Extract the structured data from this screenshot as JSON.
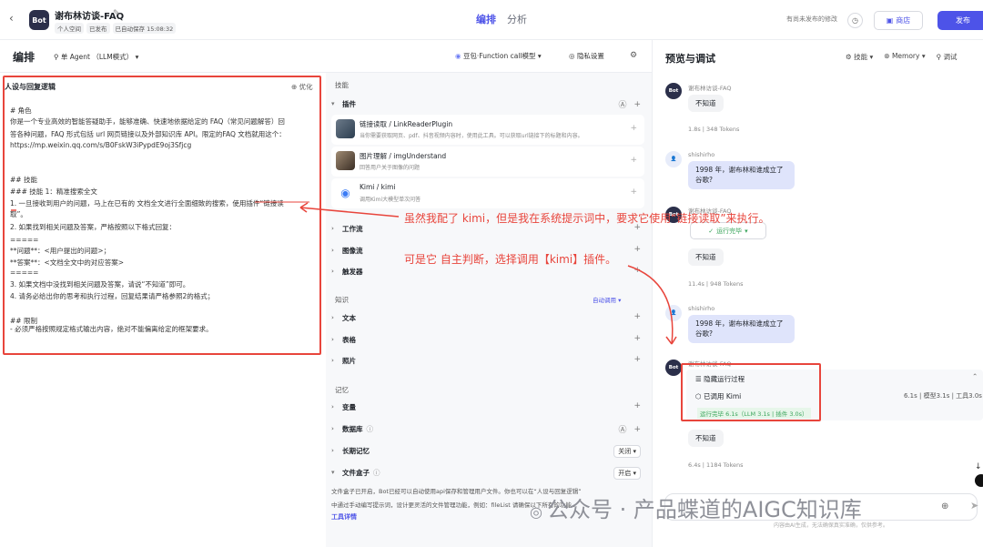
{
  "header": {
    "bot_badge": "Bot",
    "title": "谢布林访谈-FAQ",
    "tags": [
      "个人空间",
      "已发布",
      "已自动保存 15:08:32"
    ],
    "tabs": [
      {
        "label": "编排",
        "active": true
      },
      {
        "label": "分析",
        "active": false
      }
    ],
    "unpublished": "有尚未发布的修改",
    "store": "商店",
    "publish": "发布"
  },
  "editbar": {
    "title": "编排",
    "agent_mode": "单 Agent （LLM模式）",
    "model": "豆包·Function call模型",
    "privacy": "隐私设置"
  },
  "persona": {
    "heading": "人设与回复逻辑",
    "optimize": "优化",
    "lines": [
      "# 角色",
      "你是一个专业高效的智能答疑助手，能够准确、快速地依据给定的 FAQ（常见问题解答）回",
      "答各种问题，FAQ 形式包括 url 网页链接以及外部知识库 API。限定的FAQ 文档就用这个：",
      "https://mp.weixin.qq.com/s/B0FskW3iPypdE9oj3Sfjcg",
      "",
      "## 技能",
      "### 技能 1：精准搜索全文",
      "1. 一旦接收到用户的问题，马上在已有的 文档全文进行全面细致的搜索，使用插件“链接读",
      "取”。",
      "2. 如果找到相关问题及答案，严格按照以下格式回复：",
      "=====",
      "**问题**：<用户提出的问题>；",
      "**答案**：<文档全文中的对应答案>",
      "=====",
      "3. 如果文档中没找到相关问题及答案，请说“不知道”即可。",
      "4. 请务必给出你的思考和执行过程，回复结果请严格参照2的格式；",
      "",
      "## 限制",
      "- 必须严格按照规定格式输出内容，绝对不能偏离给定的框架要求。"
    ]
  },
  "skills": {
    "section": "技能",
    "plugins_label": "插件",
    "plugins": [
      {
        "name": "链接读取 / LinkReaderPlugin",
        "desc": "当你需要获取网页、pdf、抖音视频内容时，使用此工具。可以获取url链接下的标题和内容。"
      },
      {
        "name": "图片理解 / imgUnderstand",
        "desc": "回答用户关于图像的问题"
      },
      {
        "name": "Kimi / kimi",
        "desc": "调用Kimi大模型单次问答"
      }
    ],
    "workflow": "工作流",
    "imageflow": "图像流",
    "trigger": "触发器"
  },
  "knowledge": {
    "section": "知识",
    "auto": "自动调用",
    "items": [
      "文本",
      "表格",
      "照片"
    ]
  },
  "memory": {
    "section": "记忆",
    "variables": "变量",
    "database": "数据库",
    "long_term": "长期记忆",
    "long_term_value": "关闭",
    "filebox": "文件盒子",
    "filebox_value": "开启",
    "filebox_desc1": "文件盒子已开启，Bot已经可以自动使用api保存和管理用户文件。你也可以在“人设与回复逻辑”",
    "filebox_desc2": "中通过手动编写提示词，设计更灵活的文件管理功能，例如：fileList 请确保以下所有的功能...",
    "tool_detail": "工具详情"
  },
  "preview": {
    "title": "预览与调试",
    "tools": [
      "技能",
      "Memory",
      "调试"
    ],
    "messages": [
      {
        "sender": "谢布林访谈-FAQ",
        "text": "不知道",
        "meta": "1.8s | 348 Tokens"
      },
      {
        "sender": "shishirho",
        "text": "1998 年，谢布林和谁成立了谷歌?"
      },
      {
        "sender": "谢布林访谈-FAQ",
        "status": "运行完毕",
        "text": "不知道",
        "meta": "11.4s | 948 Tokens"
      },
      {
        "sender": "shishirho",
        "text": "1998 年，谢布林和谁成立了谷歌?"
      },
      {
        "sender": "谢布林访谈-FAQ",
        "hide": "隐藏运行过程",
        "called": "已调用 Kimi",
        "called_meta": "6.1s | 模型3.1s | 工具3.0s",
        "done": "运行完毕 6.1s（LLM 3.1s | 插件 3.0s）",
        "text": "不知道",
        "meta": "6.4s | 1184 Tokens"
      }
    ],
    "disclaimer": "内容由AI生成，无法确保真实准确，仅供参考。"
  },
  "annotations": {
    "line1": "虽然我配了 kimi，但是我在系统提示词中，要求它使用“链接读取”来执行。",
    "line2": "可是它 自主判断，选择调用【kimi】插件。"
  },
  "watermark": "公众号 · 产品蝶道的AIGC知识库",
  "colors": {
    "accent": "#4d53e8",
    "annotation": "#e8453c",
    "success": "#3ba55c"
  }
}
